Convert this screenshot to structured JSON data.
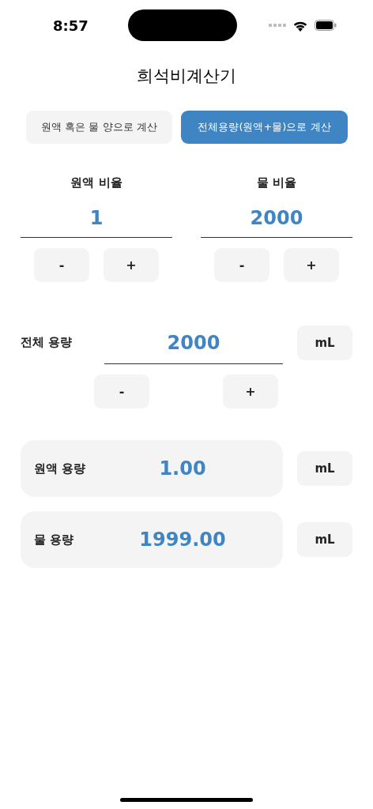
{
  "status_bar": {
    "time": "8:57"
  },
  "title": "희석비계산기",
  "tabs": [
    {
      "label": "원액 혹은 물 양으로 계산",
      "selected": false
    },
    {
      "label": "전체용량(원액+물)으로 계산",
      "selected": true
    }
  ],
  "ratios": [
    {
      "label": "원액 비율",
      "value": "1",
      "buttons": [
        "-",
        "+"
      ]
    },
    {
      "label": "물 비율",
      "value": "2000",
      "buttons": [
        "-",
        "+"
      ]
    }
  ],
  "total": {
    "label": "전체 용량",
    "value": "2000",
    "unit": "mL",
    "buttons": [
      "-",
      "+"
    ]
  },
  "results": [
    {
      "label": "원액 용량",
      "value": "1.00",
      "unit": "mL"
    },
    {
      "label": "물 용량",
      "value": "1999.00",
      "unit": "mL"
    }
  ]
}
